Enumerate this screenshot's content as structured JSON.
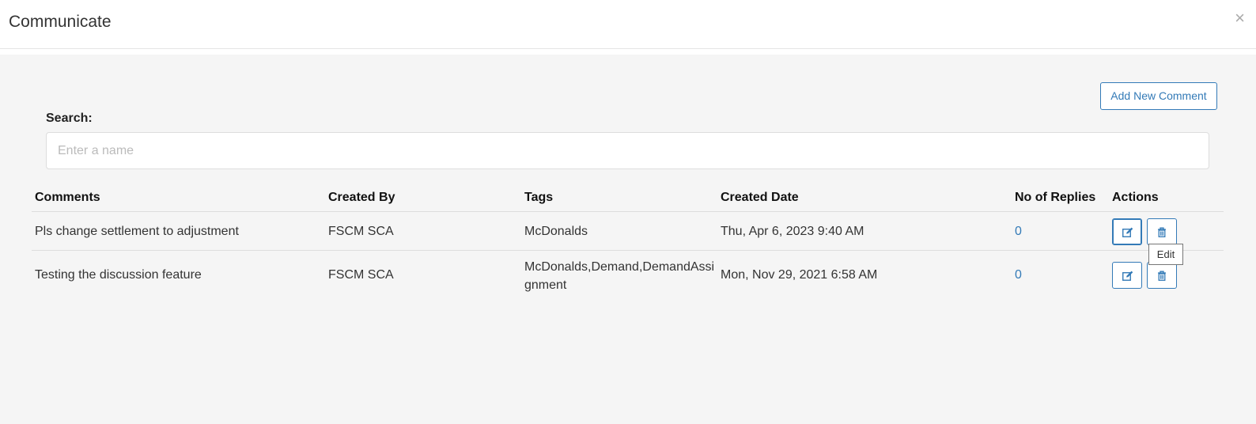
{
  "modal": {
    "title": "Communicate",
    "close_glyph": "×"
  },
  "toolbar": {
    "add_label": "Add New Comment"
  },
  "search": {
    "label": "Search:",
    "placeholder": "Enter a name"
  },
  "table": {
    "headers": [
      "Comments",
      "Created By",
      "Tags",
      "Created Date",
      "No of Replies",
      "Actions"
    ],
    "rows": [
      {
        "comment": "Pls change settlement to adjustment",
        "created_by": "FSCM SCA",
        "tags": "McDonalds",
        "created_date": "Thu, Apr 6, 2023 9:40 AM",
        "replies": "0"
      },
      {
        "comment": "Testing the discussion feature",
        "created_by": "FSCM SCA",
        "tags": "McDonalds,Demand,DemandAssignment",
        "created_date": "Mon, Nov 29, 2021 6:58 AM",
        "replies": "0"
      }
    ],
    "action_icons": [
      "edit-icon",
      "trash-icon"
    ]
  },
  "tooltip": {
    "text": "Edit"
  },
  "colors": {
    "accent": "#337ab7",
    "body_bg": "#f5f5f5"
  }
}
